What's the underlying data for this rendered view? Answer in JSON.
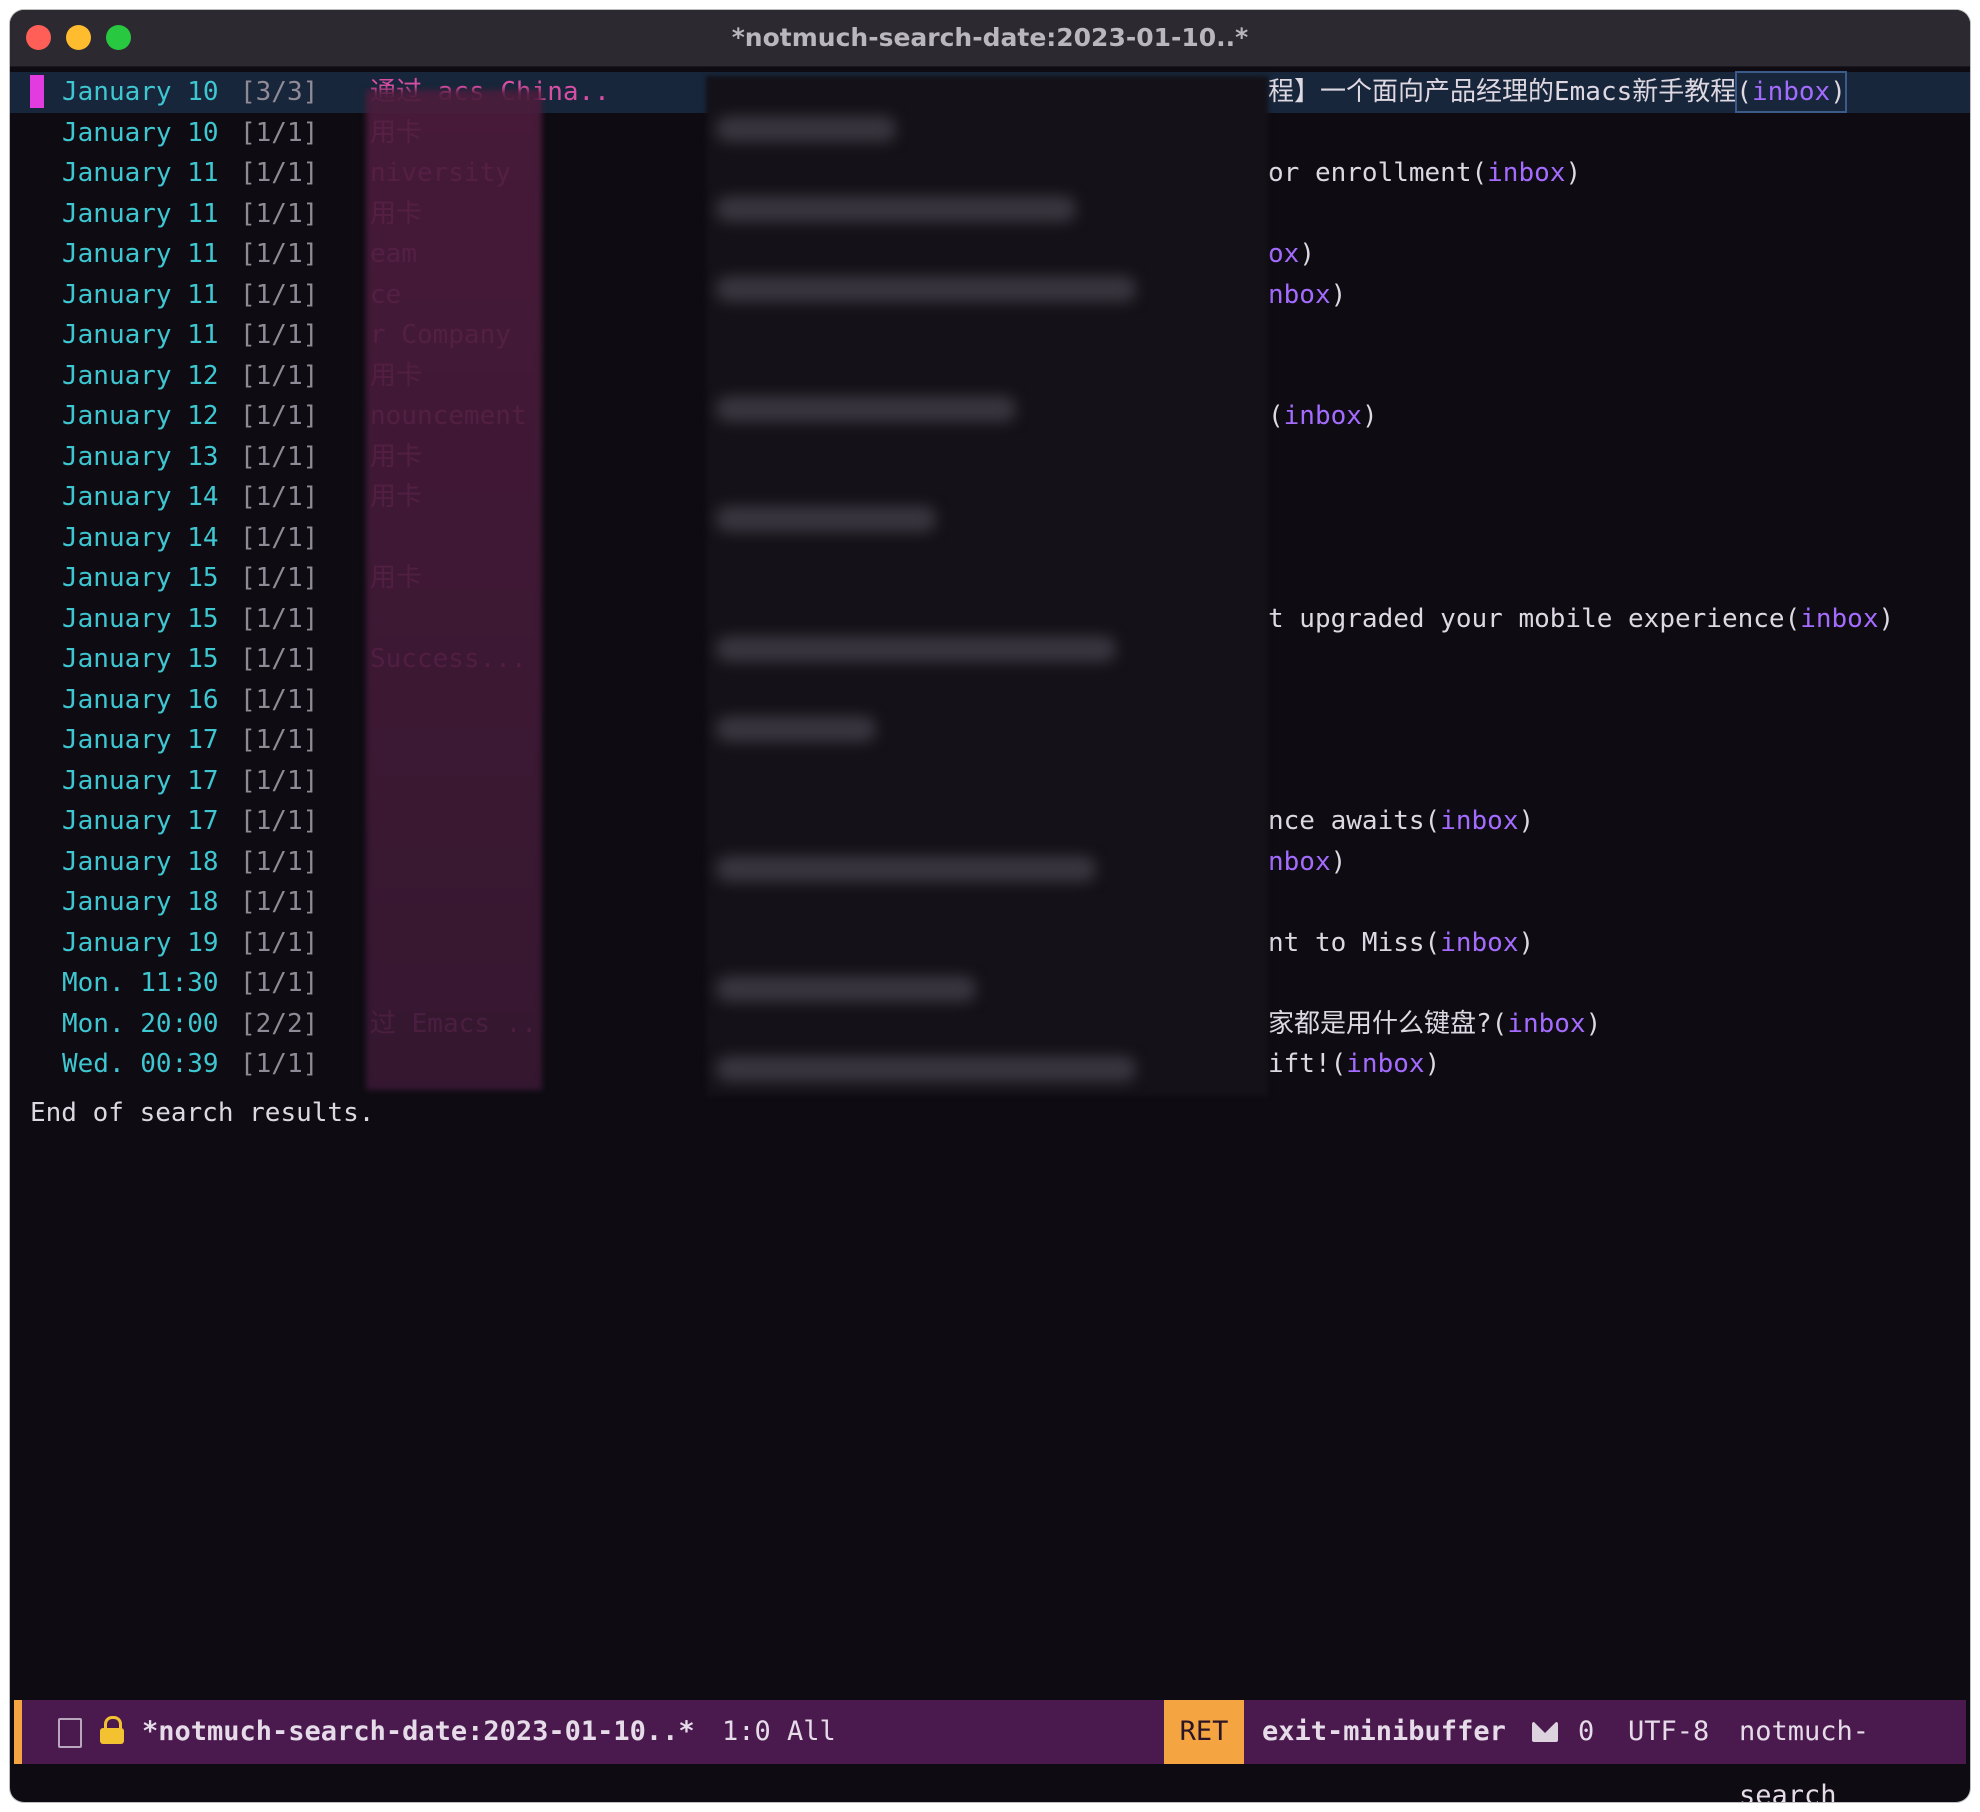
{
  "window": {
    "title": "*notmuch-search-date:2023-01-10..*"
  },
  "results": [
    {
      "date": "January 10",
      "count": "[3/3]",
      "author": "通过  acs China..",
      "subject": "程】一个面向产品经理的Emacs新手教程 ",
      "tag": "inbox"
    },
    {
      "date": "January 10",
      "count": "[1/1]",
      "author": "用卡",
      "subject": "",
      "tag": ""
    },
    {
      "date": "January 11",
      "count": "[1/1]",
      "author": "niversity",
      "subject": "or enrollment ",
      "tag": "inbox"
    },
    {
      "date": "January 11",
      "count": "[1/1]",
      "author": "用卡",
      "subject": "",
      "tag": ""
    },
    {
      "date": "January 11",
      "count": "[1/1]",
      "author": "eam",
      "subject": "",
      "tag": "ox"
    },
    {
      "date": "January 11",
      "count": "[1/1]",
      "author": "ce",
      "subject": "",
      "tag": "nbox"
    },
    {
      "date": "January 11",
      "count": "[1/1]",
      "author": "r Company",
      "subject": "",
      "tag": ""
    },
    {
      "date": "January 12",
      "count": "[1/1]",
      "author": "用卡",
      "subject": "",
      "tag": ""
    },
    {
      "date": "January 12",
      "count": "[1/1]",
      "author": "nouncement",
      "subject": "",
      "tag": "inbox"
    },
    {
      "date": "January 13",
      "count": "[1/1]",
      "author": "用卡",
      "subject": "",
      "tag": ""
    },
    {
      "date": "January 14",
      "count": "[1/1]",
      "author": "用卡",
      "subject": "",
      "tag": ""
    },
    {
      "date": "January 14",
      "count": "[1/1]",
      "author": "",
      "subject": "",
      "tag": ""
    },
    {
      "date": "January 15",
      "count": "[1/1]",
      "author": "用卡",
      "subject": "",
      "tag": ""
    },
    {
      "date": "January 15",
      "count": "[1/1]",
      "author": "",
      "subject": "t upgraded your mobile experience ",
      "tag": "inbox"
    },
    {
      "date": "January 15",
      "count": "[1/1]",
      "author": "Success...",
      "subject": "",
      "tag": ""
    },
    {
      "date": "January 16",
      "count": "[1/1]",
      "author": "",
      "subject": "",
      "tag": ""
    },
    {
      "date": "January 17",
      "count": "[1/1]",
      "author": "",
      "subject": "",
      "tag": ""
    },
    {
      "date": "January 17",
      "count": "[1/1]",
      "author": "",
      "subject": "",
      "tag": ""
    },
    {
      "date": "January 17",
      "count": "[1/1]",
      "author": "",
      "subject": "nce awaits ",
      "tag": "inbox"
    },
    {
      "date": "January 18",
      "count": "[1/1]",
      "author": "",
      "subject": "",
      "tag": "nbox"
    },
    {
      "date": "January 18",
      "count": "[1/1]",
      "author": "",
      "subject": "",
      "tag": ""
    },
    {
      "date": "January 19",
      "count": "[1/1]",
      "author": "",
      "subject": "nt to Miss ",
      "tag": "inbox"
    },
    {
      "date": "Mon. 11:30",
      "count": "[1/1]",
      "author": "",
      "subject": "",
      "tag": ""
    },
    {
      "date": "Mon. 20:00",
      "count": "[2/2]",
      "author": "过 Emacs ..",
      "subject": "家都是用什么键盘?  ",
      "tag": "inbox"
    },
    {
      "date": "Wed. 00:39",
      "count": "[1/1]",
      "author": "",
      "subject": "ift! ",
      "tag": "inbox"
    }
  ],
  "end_text": "End of search results.",
  "modeline": {
    "buffer": "*notmuch-search-date:2023-01-10..*",
    "position": "1:0 All",
    "key": "RET",
    "command": "exit-minibuffer",
    "mail_count": "0",
    "encoding": "UTF-8",
    "mode": "notmuch-search"
  },
  "colors": {
    "background": "#0e0b12",
    "date": "#3ec6d1",
    "author": "#d64fa4",
    "tag": "#a46bff",
    "modeline": "#4a1a4e",
    "accent": "#f5a442"
  },
  "icons": [
    "file-icon",
    "lock-icon",
    "mail-icon"
  ]
}
